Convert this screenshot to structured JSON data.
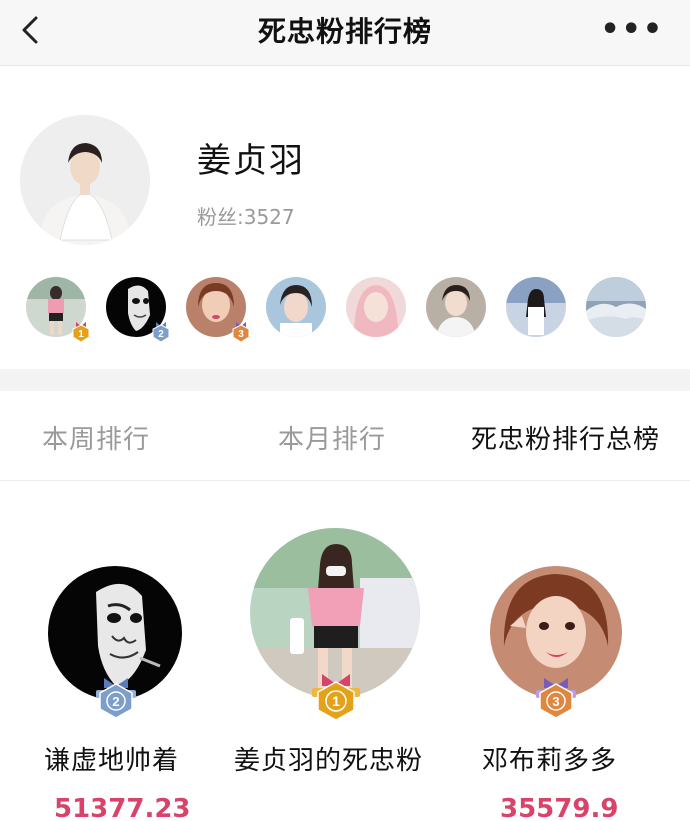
{
  "navbar": {
    "title": "死忠粉排行榜",
    "back_icon": "chevron-left-icon",
    "more_icon": "more-dots-icon",
    "more_label": "•••"
  },
  "profile": {
    "name": "姜贞羽",
    "fans_label": "粉丝:3527",
    "fan_avatars": [
      {
        "rank": 1,
        "badge": "1"
      },
      {
        "rank": 2,
        "badge": "2"
      },
      {
        "rank": 3,
        "badge": "3"
      },
      {
        "rank": 4,
        "badge": ""
      },
      {
        "rank": 5,
        "badge": ""
      },
      {
        "rank": 6,
        "badge": ""
      },
      {
        "rank": 7,
        "badge": ""
      },
      {
        "rank": 8,
        "badge": ""
      }
    ]
  },
  "tabs": [
    {
      "label": "本周排行",
      "active": false
    },
    {
      "label": "本月排行",
      "active": false
    },
    {
      "label": "死忠粉排行总榜",
      "active": true
    }
  ],
  "podium": {
    "first": {
      "name": "姜贞羽的死忠粉",
      "score": "",
      "badge": "1"
    },
    "second": {
      "name": "谦虚地帅着",
      "score": "51377.23",
      "badge": "2"
    },
    "third": {
      "name": "邓布莉多多",
      "score": "35579.9",
      "badge": "3"
    }
  },
  "colors": {
    "score": "#d9436a",
    "gold": "#e3a21a",
    "silver": "#7d9ec9",
    "bronze": "#e0873f"
  }
}
